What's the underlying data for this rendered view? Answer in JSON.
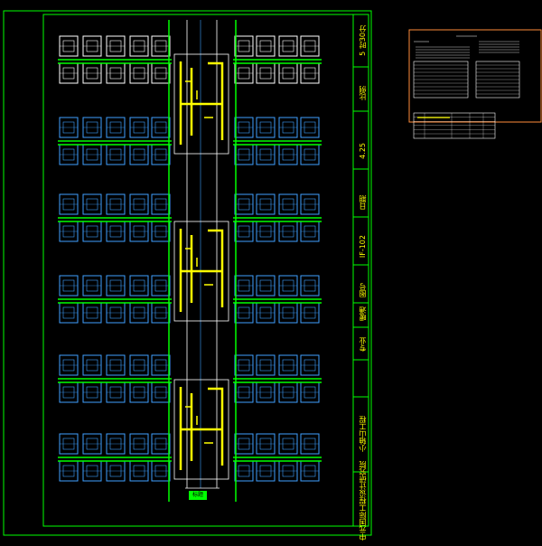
{
  "sheet": {
    "title_block": {
      "designer": "中元国际工程设计研究院",
      "project": "小轴山工程",
      "discipline": "专业",
      "drawing_label": "暖通",
      "number_label": "图号",
      "number": "IF-102",
      "date_label": "日期",
      "date": "4.25",
      "scale_label": "比例",
      "scale": "5 时30分"
    },
    "plan_caption": "标题",
    "colors": {
      "frame": "#00ff00",
      "walls": "#ffffff",
      "rooms": "#3fa0ff",
      "ducts": "#ffff00",
      "pipes": "#00ff00",
      "notes_frame": "#ff8c3a"
    }
  }
}
